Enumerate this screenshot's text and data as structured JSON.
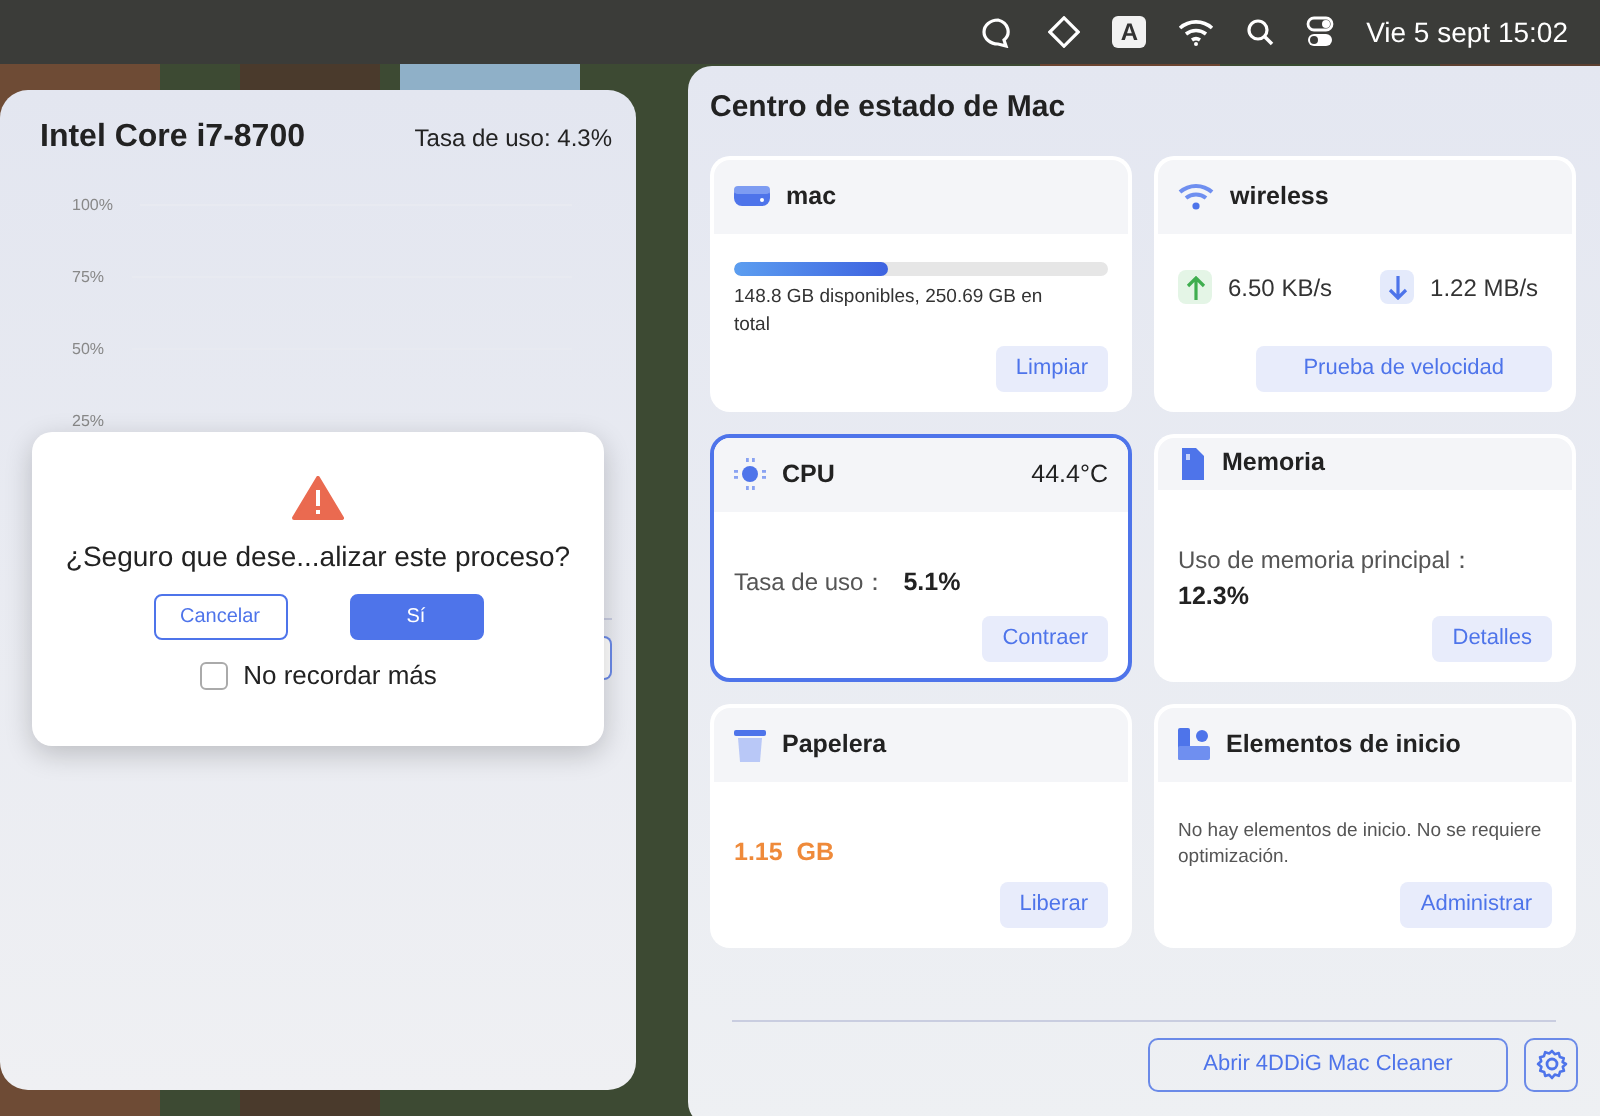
{
  "menu_bar": {
    "input_source": "A",
    "clock": "Vie 5 sept 15:02"
  },
  "cpu_panel": {
    "title": "Intel Core i7-8700",
    "usage": "Tasa de uso: 4.3%",
    "y_ticks": [
      "100%",
      "75%",
      "50%",
      "25%"
    ]
  },
  "dialog": {
    "message": "¿Seguro que dese...alizar este proceso?",
    "buttons": [
      {
        "label": "Cancelar",
        "kind": "secondary"
      },
      {
        "label": "Sí",
        "kind": "primary"
      }
    ],
    "checkbox": {
      "label": "No recordar más",
      "checked": false
    }
  },
  "status_center": {
    "title": "Centro de estado de Mac",
    "cards": [
      {
        "kind": "disk",
        "title": "mac",
        "selected": false,
        "level": 0.41,
        "detail": "148.8 GB disponibles, 250.69 GB en total",
        "button": "Limpiar"
      },
      {
        "kind": "network",
        "title": "wireless",
        "selected": false,
        "upload": "6.50 KB/s",
        "download": "1.22 MB/s",
        "button": "Prueba de velocidad"
      },
      {
        "kind": "cpu",
        "title": "CPU",
        "selected": true,
        "temperature": "44.4°C",
        "label": "Tasa de uso：",
        "value": "5.1%",
        "button": "Contraer"
      },
      {
        "kind": "memory",
        "title": "Memoria",
        "selected": false,
        "label": "Uso de memoria principal：",
        "value": "12.3%",
        "button": "Detalles"
      },
      {
        "kind": "trash",
        "title": "Papelera",
        "selected": false,
        "value": "1.15  GB",
        "button": "Liberar"
      },
      {
        "kind": "startup",
        "title": "Elementos de inicio",
        "selected": false,
        "detail": "No hay elementos de inicio. No se requiere optimización.",
        "button": "Administrar"
      }
    ],
    "open_button": "Abrir 4DDiG Mac Cleaner"
  }
}
